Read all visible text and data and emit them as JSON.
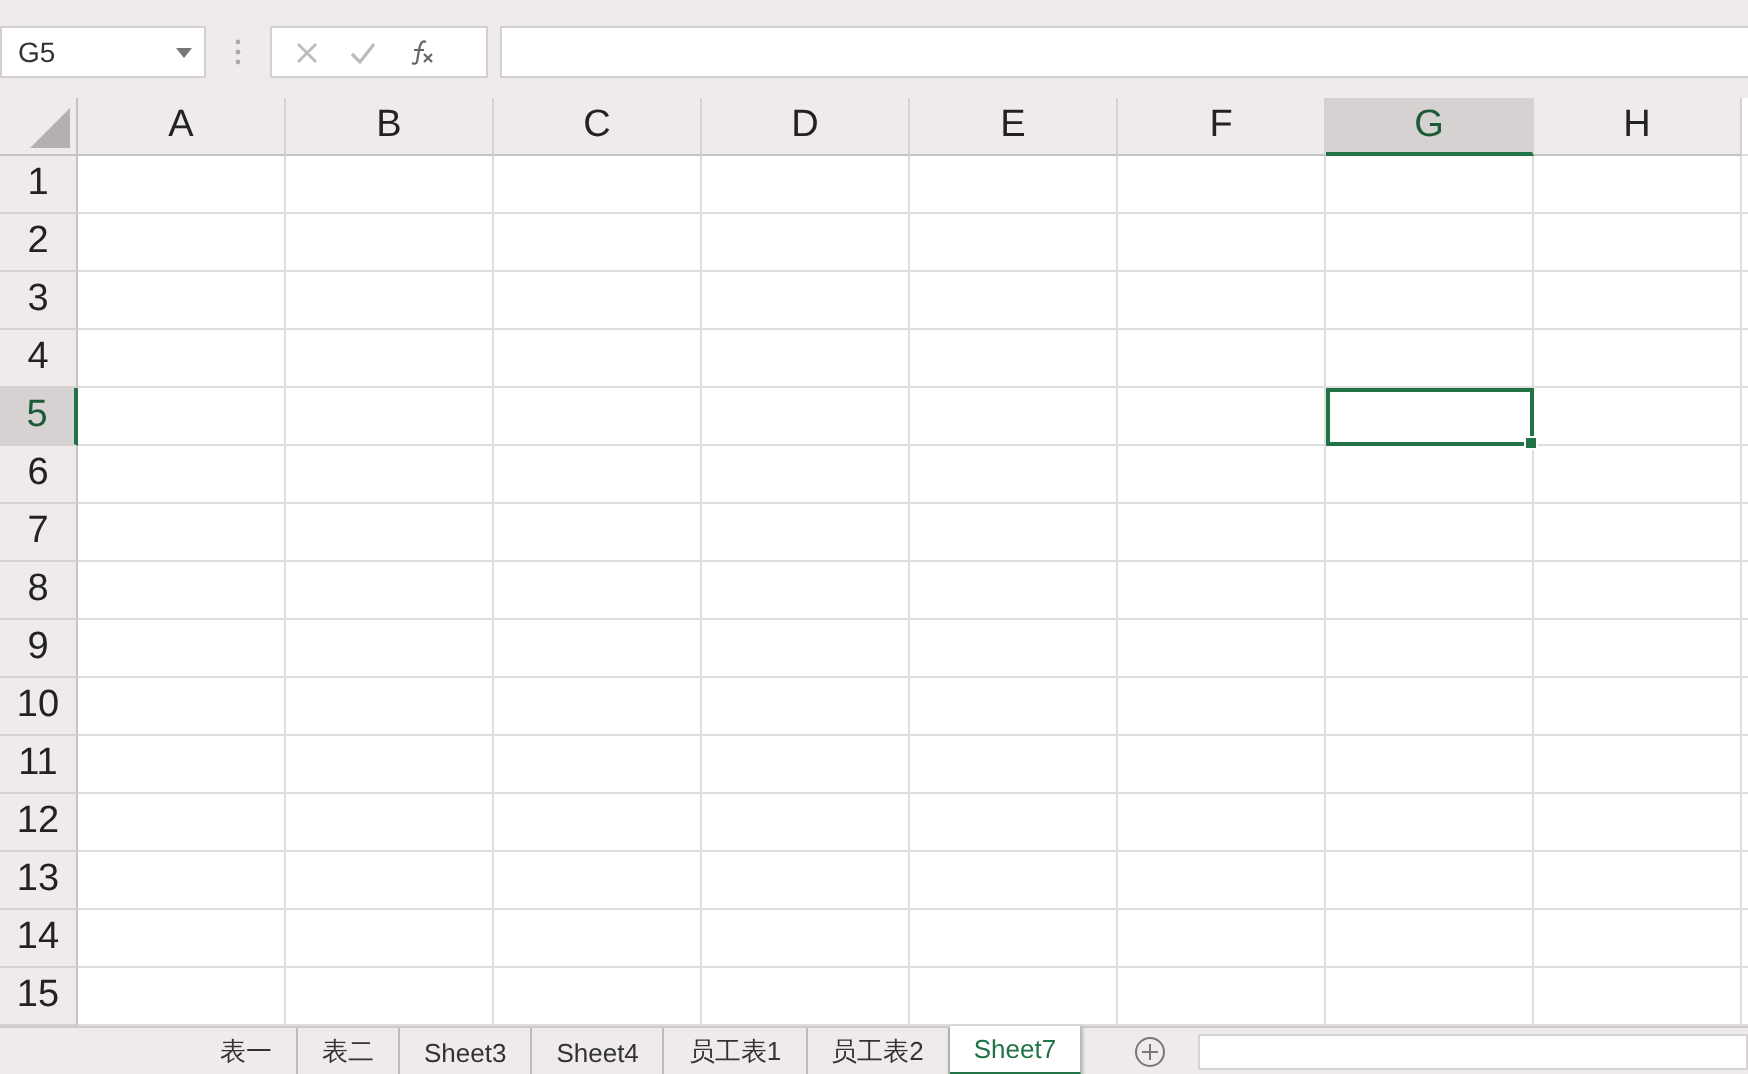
{
  "name_box": {
    "value": "G5"
  },
  "columns": [
    {
      "label": "A",
      "selected": false
    },
    {
      "label": "B",
      "selected": false
    },
    {
      "label": "C",
      "selected": false
    },
    {
      "label": "D",
      "selected": false
    },
    {
      "label": "E",
      "selected": false
    },
    {
      "label": "F",
      "selected": false
    },
    {
      "label": "G",
      "selected": true
    },
    {
      "label": "H",
      "selected": false
    }
  ],
  "rows": [
    {
      "label": "1",
      "selected": false
    },
    {
      "label": "2",
      "selected": false
    },
    {
      "label": "3",
      "selected": false
    },
    {
      "label": "4",
      "selected": false
    },
    {
      "label": "5",
      "selected": true
    },
    {
      "label": "6",
      "selected": false
    },
    {
      "label": "7",
      "selected": false
    },
    {
      "label": "8",
      "selected": false
    },
    {
      "label": "9",
      "selected": false
    },
    {
      "label": "10",
      "selected": false
    },
    {
      "label": "11",
      "selected": false
    },
    {
      "label": "12",
      "selected": false
    },
    {
      "label": "13",
      "selected": false
    },
    {
      "label": "14",
      "selected": false
    },
    {
      "label": "15",
      "selected": false
    }
  ],
  "sheet_tabs": [
    {
      "label": "表一",
      "selected": false
    },
    {
      "label": "表二",
      "selected": false
    },
    {
      "label": "Sheet3",
      "selected": false
    },
    {
      "label": "Sheet4",
      "selected": false
    },
    {
      "label": "员工表1",
      "selected": false
    },
    {
      "label": "员工表2",
      "selected": false
    },
    {
      "label": "Sheet7",
      "selected": true
    }
  ]
}
